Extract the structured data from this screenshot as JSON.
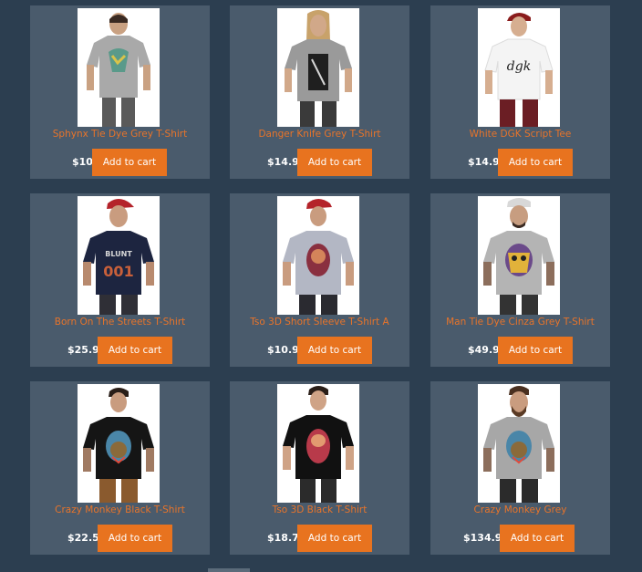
{
  "products": [
    {
      "name": "Sphynx Tie Dye Grey T-Shirt",
      "price": "$10",
      "cart_label": "Add to cart",
      "shirt_color": "#a9a9a9",
      "icon": "sphynx-tshirt-image"
    },
    {
      "name": "Danger Knife Grey T-Shirt",
      "price": "$14.9",
      "cart_label": "Add to cart",
      "shirt_color": "#9a9a9a",
      "icon": "danger-knife-tshirt-image"
    },
    {
      "name": "White DGK Script Tee",
      "price": "$14.9",
      "cart_label": "Add to cart",
      "shirt_color": "#f4f4f4",
      "icon": "dgk-tee-image"
    },
    {
      "name": "Born On The Streets T-Shirt",
      "price": "$25.9",
      "cart_label": "Add to cart",
      "shirt_color": "#1d2540",
      "icon": "born-streets-tshirt-image"
    },
    {
      "name": "Tso 3D Short Sleeve T-Shirt A",
      "price": "$10.9",
      "cart_label": "Add to cart",
      "shirt_color": "#b3b7c4",
      "icon": "tso-3d-tshirt-image"
    },
    {
      "name": "Man Tie Dye Cinza Grey T-Shirt",
      "price": "$49.9",
      "cart_label": "Add to cart",
      "shirt_color": "#b4b4b4",
      "icon": "man-tie-dye-tshirt-image"
    },
    {
      "name": "Crazy Monkey Black T-Shirt",
      "price": "$22.5",
      "cart_label": "Add to cart",
      "shirt_color": "#151515",
      "icon": "crazy-monkey-black-tshirt-image"
    },
    {
      "name": "Tso 3D Black T-Shirt",
      "price": "$18.7",
      "cart_label": "Add to cart",
      "shirt_color": "#111111",
      "icon": "tso-3d-black-tshirt-image"
    },
    {
      "name": "Crazy Monkey Grey",
      "price": "$134.9",
      "cart_label": "Add to cart",
      "shirt_color": "#a7a7a7",
      "icon": "crazy-monkey-grey-tshirt-image"
    }
  ]
}
